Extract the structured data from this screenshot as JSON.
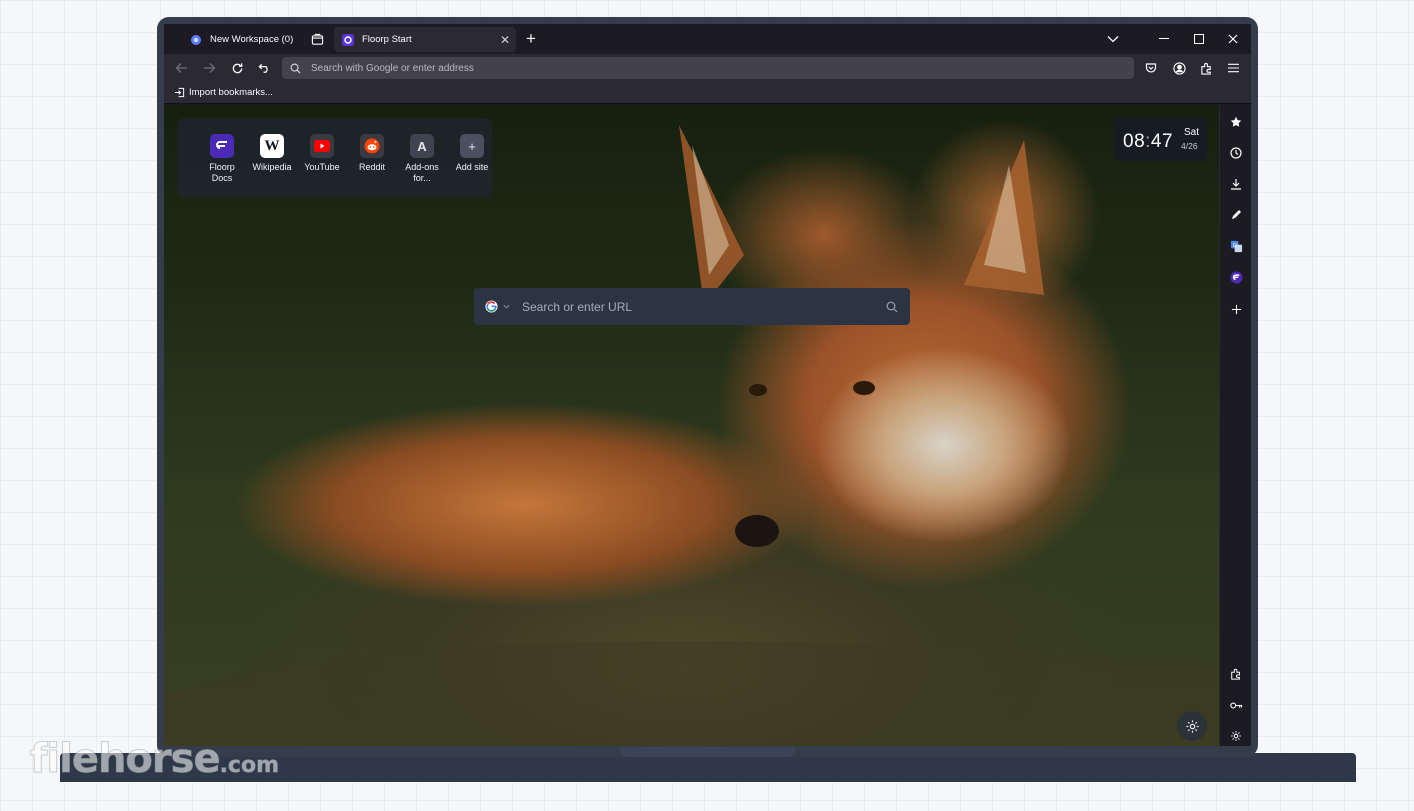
{
  "tabs": {
    "workspace_label": "New Workspace (0)",
    "active_label": "Floorp Start",
    "close_glyph": "✕",
    "new_tab_glyph": "+"
  },
  "window_controls": {
    "dropdown": "⌄",
    "minimize": "—",
    "maximize": "☐",
    "close": "✕"
  },
  "toolbar": {
    "url_placeholder": "Search with Google or enter address"
  },
  "bookmarks_bar": {
    "import_label": "Import bookmarks..."
  },
  "speed_dial": [
    {
      "label": "Floorp Docs",
      "icon": "floorp-icon",
      "bg": "#4b2bb5",
      "glyph": "F"
    },
    {
      "label": "Wikipedia",
      "icon": "wikipedia-icon",
      "bg": "#ffffff",
      "glyph": "W"
    },
    {
      "label": "YouTube",
      "icon": "youtube-icon",
      "bg": "#3a3a40",
      "glyph": "▶"
    },
    {
      "label": "Reddit",
      "icon": "reddit-icon",
      "bg": "#3a3a40",
      "glyph": "●"
    },
    {
      "label": "Add-ons for...",
      "icon": "addons-icon",
      "bg": "#3f4450",
      "glyph": "A"
    },
    {
      "label": "Add site",
      "icon": "plus-icon",
      "bg": "#4a5060",
      "glyph": "+"
    }
  ],
  "clock": {
    "time_h": "08",
    "time_m": "47",
    "day": "Sat",
    "date": "4/26"
  },
  "search": {
    "placeholder": "Search or enter URL",
    "engine": "google-icon"
  },
  "sidebar_icons": [
    "star-icon",
    "history-icon",
    "download-icon",
    "pen-icon",
    "translate-icon",
    "floorp-icon",
    "plus-icon",
    "extensions-icon",
    "key-icon",
    "gear-icon"
  ],
  "watermark": {
    "brand": "filehorse",
    "tld": ".com"
  },
  "colors": {
    "accent": "#4b2bb5",
    "chrome_dark": "#1c1b22",
    "toolbar": "#2b2a33",
    "laptop": "#353d4c"
  }
}
